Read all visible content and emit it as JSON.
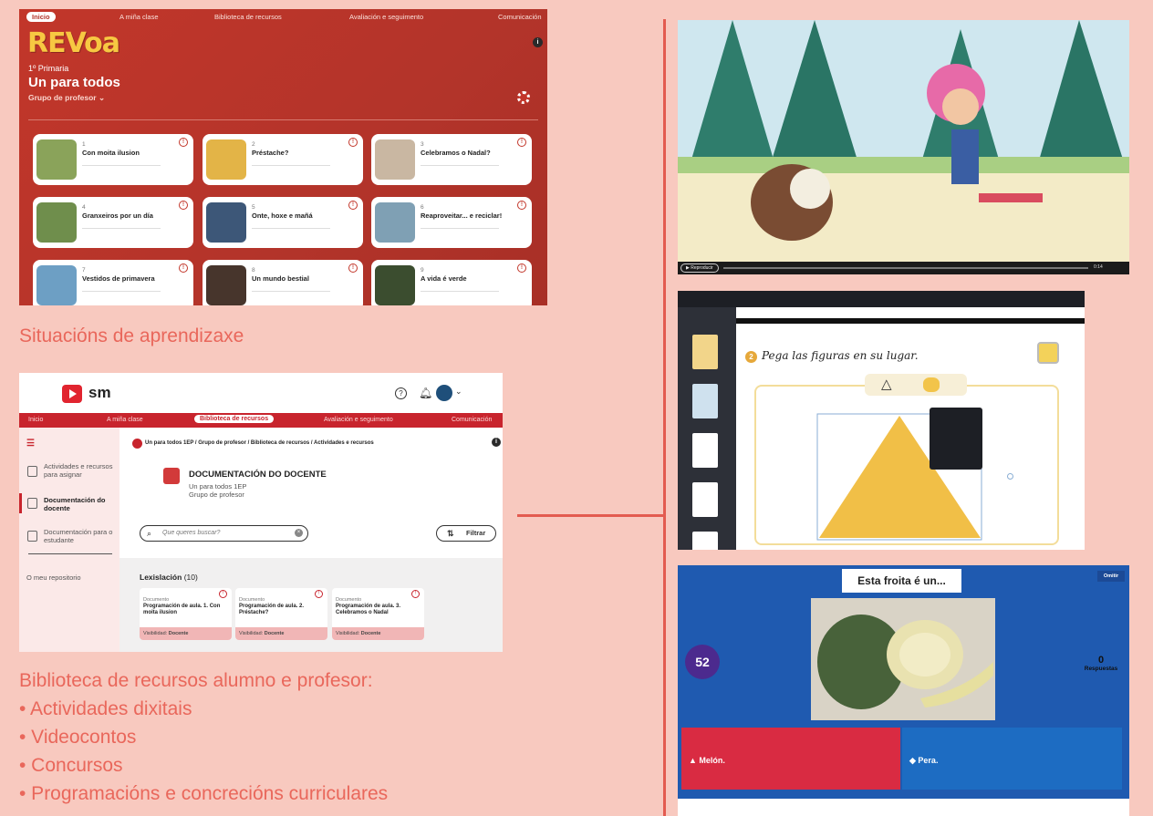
{
  "revoa": {
    "nav": {
      "home": "Inicio",
      "class": "A miña clase",
      "library": "Biblioteca de recursos",
      "eval": "Avaliación e seguimento",
      "comm": "Comunicación"
    },
    "logo": "REVoa",
    "grade": "1º Primaria",
    "subject": "Un para todos",
    "group": "Grupo de profesor",
    "cards": [
      {
        "num": "1",
        "title": "Con moita ilusion",
        "color": "#8aa35a"
      },
      {
        "num": "2",
        "title": "Préstache?",
        "color": "#e3b447"
      },
      {
        "num": "3",
        "title": "Celebramos o Nadal?",
        "color": "#c9b7a2"
      },
      {
        "num": "4",
        "title": "Granxeiros por un día",
        "color": "#6f8e4c"
      },
      {
        "num": "5",
        "title": "Onte, hoxe e mañá",
        "color": "#3d5778"
      },
      {
        "num": "6",
        "title": "Reaproveitar... e reciclar!",
        "color": "#7fa0b4"
      },
      {
        "num": "7",
        "title": "Vestidos de primavera",
        "color": "#6d9fc4"
      },
      {
        "num": "8",
        "title": "Un mundo bestial",
        "color": "#47352c"
      },
      {
        "num": "9",
        "title": "A vida é verde",
        "color": "#3b4d2f"
      }
    ]
  },
  "captions": {
    "learning": "Situacións de aprendizaxe",
    "library": "Biblioteca de recursos alumno e profesor:",
    "bullets": [
      "• Actividades dixitais",
      "• Videocontos",
      "• Concursos",
      "• Programacións e concrecións curriculares"
    ]
  },
  "library": {
    "brand": "sm",
    "nav": {
      "home": "Inicio",
      "class": "A miña clase",
      "library": "Biblioteca de recursos",
      "eval": "Avaliación e seguimento",
      "comm": "Comunicación"
    },
    "side": {
      "assign": "Actividades e recursos para asignar",
      "teacher": "Documentación do docente",
      "student": "Documentación para o estudante",
      "repo": "O meu repositorio"
    },
    "breadcrumb": "Un para todos 1EP  /  Grupo de profesor  /  Biblioteca de recursos  /  Actividades e recursos",
    "doc_title": "DOCUMENTACIÓN DO DOCENTE",
    "doc_sub1": "Un para todos 1EP",
    "doc_sub2": "Grupo de profesor",
    "search_placeholder": "Que queres buscar?",
    "filter": "Filtrar",
    "section": "Lexislación",
    "section_count": "(10)",
    "docs": [
      {
        "kind": "Documento",
        "title": "Programación de aula. 1. Con moita ilusion",
        "vis": "Visibilidad:",
        "vis_val": "Docente"
      },
      {
        "kind": "Documento",
        "title": "Programación de aula. 2. Préstache?",
        "vis": "Visibilidad:",
        "vis_val": "Docente"
      },
      {
        "kind": "Documento",
        "title": "Programación de aula. 3. Celebramos o Nadal",
        "vis": "Visibilidad:",
        "vis_val": "Docente"
      }
    ]
  },
  "video": {
    "play": "▶ Reproducir",
    "time": "0:14"
  },
  "editor": {
    "instruction": "Pega las figuras en su lugar.",
    "step": "2",
    "shape": "△"
  },
  "quiz": {
    "title": "Esta froita é un...",
    "skip": "Omitir",
    "timer": "52",
    "answers_count": "0",
    "answers_label": "Respuestas",
    "optionA": "▲ Melón.",
    "optionB": "◆ Pera."
  }
}
